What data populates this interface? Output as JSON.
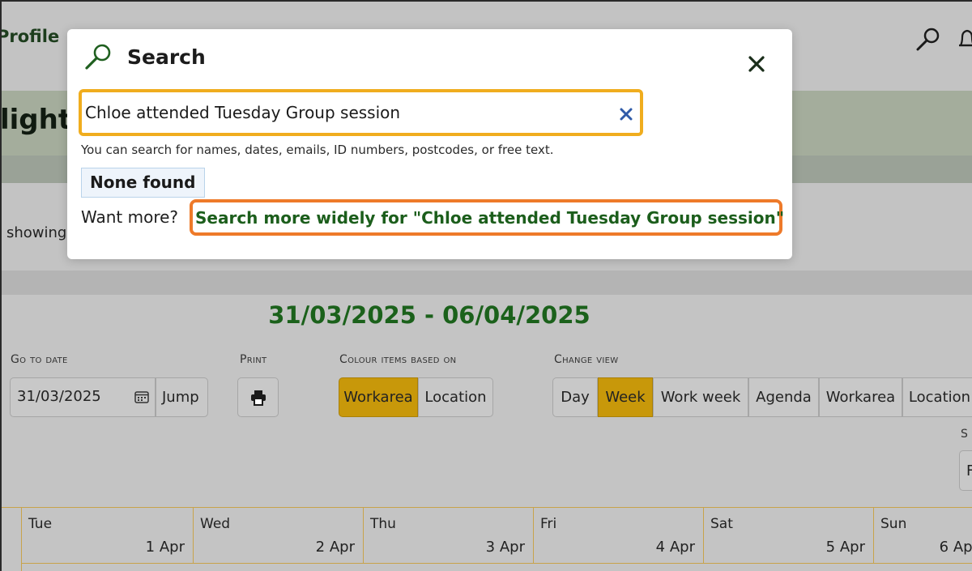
{
  "app": {
    "profile_label": "Profile",
    "page_title_fragment": "light",
    "showing_fragment": "showing",
    "icons": {
      "top_search": "search-icon",
      "notifications": "bell-icon"
    }
  },
  "modal": {
    "title": "Search",
    "icon": "magnifier-icon",
    "close_icon": "close-icon",
    "search_value": "Chloe attended Tuesday Group session",
    "clear_icon": "clear-icon",
    "help_text": "You can search for names, dates, emails, ID numbers, postcodes, or free text.",
    "none_found": "None found",
    "want_more": "Want more?",
    "more_link": "Search more widely for \"Chloe attended Tuesday Group session\"",
    "colors": {
      "search_border": "#f0ad1e",
      "link_border": "#ee7a2a",
      "link_text": "#1c5e1c"
    }
  },
  "calendar": {
    "date_range": "31/03/2025 - 06/04/2025",
    "go_to_date_label": "Go to date",
    "date_value": "31/03/2025",
    "jump_label": "Jump",
    "print_label": "Print",
    "colour_label": "Colour items based on",
    "colour_options": [
      "Workarea",
      "Location"
    ],
    "colour_selected": "Workarea",
    "change_view_label": "Change view",
    "view_options": [
      "Day",
      "Week",
      "Work week",
      "Agenda",
      "Workarea",
      "Location"
    ],
    "view_selected": "Week",
    "partial_label": "S",
    "partial_button": "F",
    "days": [
      {
        "name": "Tue",
        "date": "1 Apr"
      },
      {
        "name": "Wed",
        "date": "2 Apr"
      },
      {
        "name": "Thu",
        "date": "3 Apr"
      },
      {
        "name": "Fri",
        "date": "4 Apr"
      },
      {
        "name": "Sat",
        "date": "5 Apr"
      },
      {
        "name": "Sun",
        "date": "6 Apr"
      }
    ],
    "colors": {
      "active": "#c8980a",
      "date_range": "#1b611b",
      "grid_line": "#c8a34a"
    }
  }
}
